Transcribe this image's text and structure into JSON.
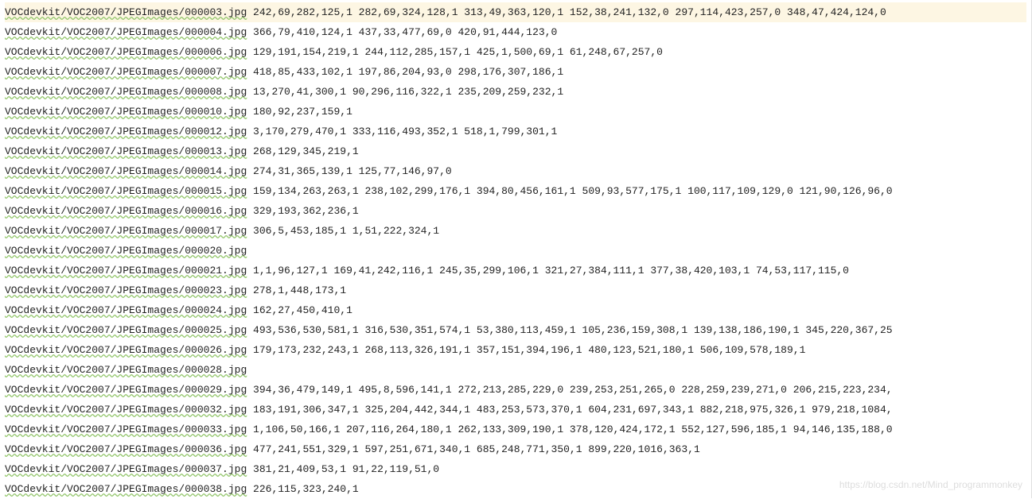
{
  "lines": [
    {
      "path": "VOCdevkit/VOC2007/JPEGImages/000003.jpg",
      "values": "242,69,282,125,1 282,69,324,128,1 313,49,363,120,1 152,38,241,132,0 297,114,423,257,0 348,47,424,124,0"
    },
    {
      "path": "VOCdevkit/VOC2007/JPEGImages/000004.jpg",
      "values": "366,79,410,124,1 437,33,477,69,0 420,91,444,123,0"
    },
    {
      "path": "VOCdevkit/VOC2007/JPEGImages/000006.jpg",
      "values": "129,191,154,219,1 244,112,285,157,1 425,1,500,69,1 61,248,67,257,0"
    },
    {
      "path": "VOCdevkit/VOC2007/JPEGImages/000007.jpg",
      "values": "418,85,433,102,1 197,86,204,93,0 298,176,307,186,1"
    },
    {
      "path": "VOCdevkit/VOC2007/JPEGImages/000008.jpg",
      "values": "13,270,41,300,1 90,296,116,322,1 235,209,259,232,1"
    },
    {
      "path": "VOCdevkit/VOC2007/JPEGImages/000010.jpg",
      "values": "180,92,237,159,1"
    },
    {
      "path": "VOCdevkit/VOC2007/JPEGImages/000012.jpg",
      "values": "3,170,279,470,1 333,116,493,352,1 518,1,799,301,1"
    },
    {
      "path": "VOCdevkit/VOC2007/JPEGImages/000013.jpg",
      "values": "268,129,345,219,1"
    },
    {
      "path": "VOCdevkit/VOC2007/JPEGImages/000014.jpg",
      "values": "274,31,365,139,1 125,77,146,97,0"
    },
    {
      "path": "VOCdevkit/VOC2007/JPEGImages/000015.jpg",
      "values": "159,134,263,263,1 238,102,299,176,1 394,80,456,161,1 509,93,577,175,1 100,117,109,129,0 121,90,126,96,0"
    },
    {
      "path": "VOCdevkit/VOC2007/JPEGImages/000016.jpg",
      "values": "329,193,362,236,1"
    },
    {
      "path": "VOCdevkit/VOC2007/JPEGImages/000017.jpg",
      "values": "306,5,453,185,1 1,51,222,324,1"
    },
    {
      "path": "VOCdevkit/VOC2007/JPEGImages/000020.jpg",
      "values": ""
    },
    {
      "path": "VOCdevkit/VOC2007/JPEGImages/000021.jpg",
      "values": "1,1,96,127,1 169,41,242,116,1 245,35,299,106,1 321,27,384,111,1 377,38,420,103,1 74,53,117,115,0"
    },
    {
      "path": "VOCdevkit/VOC2007/JPEGImages/000023.jpg",
      "values": "278,1,448,173,1"
    },
    {
      "path": "VOCdevkit/VOC2007/JPEGImages/000024.jpg",
      "values": "162,27,450,410,1"
    },
    {
      "path": "VOCdevkit/VOC2007/JPEGImages/000025.jpg",
      "values": "493,536,530,581,1 316,530,351,574,1 53,380,113,459,1 105,236,159,308,1 139,138,186,190,1 345,220,367,25"
    },
    {
      "path": "VOCdevkit/VOC2007/JPEGImages/000026.jpg",
      "values": "179,173,232,243,1 268,113,326,191,1 357,151,394,196,1 480,123,521,180,1 506,109,578,189,1"
    },
    {
      "path": "VOCdevkit/VOC2007/JPEGImages/000028.jpg",
      "values": ""
    },
    {
      "path": "VOCdevkit/VOC2007/JPEGImages/000029.jpg",
      "values": "394,36,479,149,1 495,8,596,141,1 272,213,285,229,0 239,253,251,265,0 228,259,239,271,0 206,215,223,234,"
    },
    {
      "path": "VOCdevkit/VOC2007/JPEGImages/000032.jpg",
      "values": "183,191,306,347,1 325,204,442,344,1 483,253,573,370,1 604,231,697,343,1 882,218,975,326,1 979,218,1084,"
    },
    {
      "path": "VOCdevkit/VOC2007/JPEGImages/000033.jpg",
      "values": "1,106,50,166,1 207,116,264,180,1 262,133,309,190,1 378,120,424,172,1 552,127,596,185,1 94,146,135,188,0"
    },
    {
      "path": "VOCdevkit/VOC2007/JPEGImages/000036.jpg",
      "values": "477,241,551,329,1 597,251,671,340,1 685,248,771,350,1 899,220,1016,363,1"
    },
    {
      "path": "VOCdevkit/VOC2007/JPEGImages/000037.jpg",
      "values": "381,21,409,53,1 91,22,119,51,0"
    },
    {
      "path": "VOCdevkit/VOC2007/JPEGImages/000038.jpg",
      "values": "226,115,323,240,1"
    }
  ],
  "watermark": "https://blog.csdn.net/Mind_programmonkey"
}
